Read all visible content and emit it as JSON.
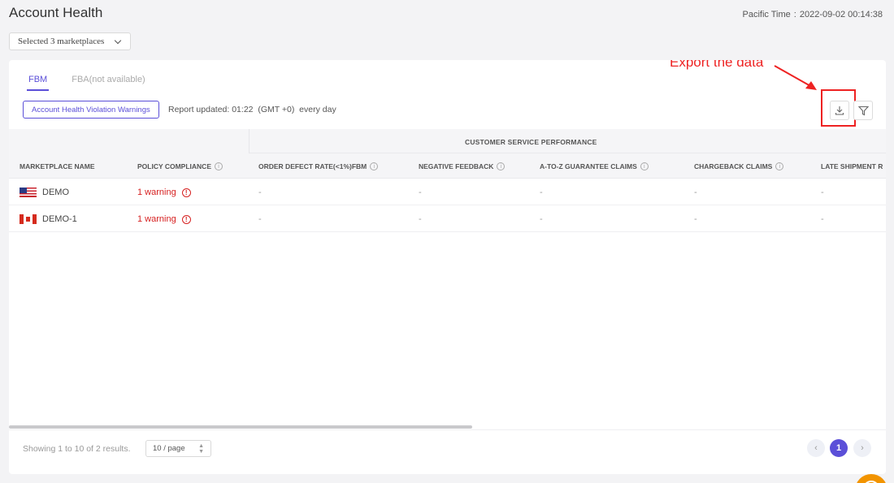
{
  "header": {
    "title": "Account Health",
    "pacific_label": "Pacific Time",
    "pacific_sep": ":",
    "pacific_value": "2022-09-02 00:14:38"
  },
  "marketplace_select": {
    "value": "Selected 3 marketplaces"
  },
  "tabs": [
    {
      "label": "FBM",
      "active": true
    },
    {
      "label": "FBA(not available)",
      "active": false
    }
  ],
  "toolbar": {
    "violation_button": "Account Health Violation Warnings",
    "report_text": "Report updated: 01:22  (GMT +0)  every day",
    "download_icon": "download-icon",
    "filter_icon": "filter-icon"
  },
  "annotation": {
    "text": "Export the data",
    "color": "#e22222"
  },
  "table": {
    "group_header": "CUSTOMER SERVICE PERFORMANCE",
    "columns": [
      "MARKETPLACE NAME",
      "POLICY COMPLIANCE",
      "ORDER DEFECT RATE(<1%)FBM",
      "NEGATIVE FEEDBACK",
      "A-TO-Z GUARANTEE CLAIMS",
      "CHARGEBACK CLAIMS",
      "LATE SHIPMENT R"
    ],
    "rows": [
      {
        "flag": "us-flag-icon",
        "name": "DEMO",
        "policy": "1 warning",
        "odr": "-",
        "neg": "-",
        "atoz": "-",
        "chargeback": "-",
        "late": "-"
      },
      {
        "flag": "canada-flag-icon",
        "name": "DEMO-1",
        "policy": "1 warning",
        "odr": "-",
        "neg": "-",
        "atoz": "-",
        "chargeback": "-",
        "late": "-"
      }
    ]
  },
  "footer": {
    "showing": "Showing 1 to 10 of 2 results.",
    "page_size": "10 / page",
    "current_page": "1"
  },
  "colors": {
    "accent": "#5b4fd8",
    "warning": "#d62020",
    "fab": "#f29400"
  }
}
